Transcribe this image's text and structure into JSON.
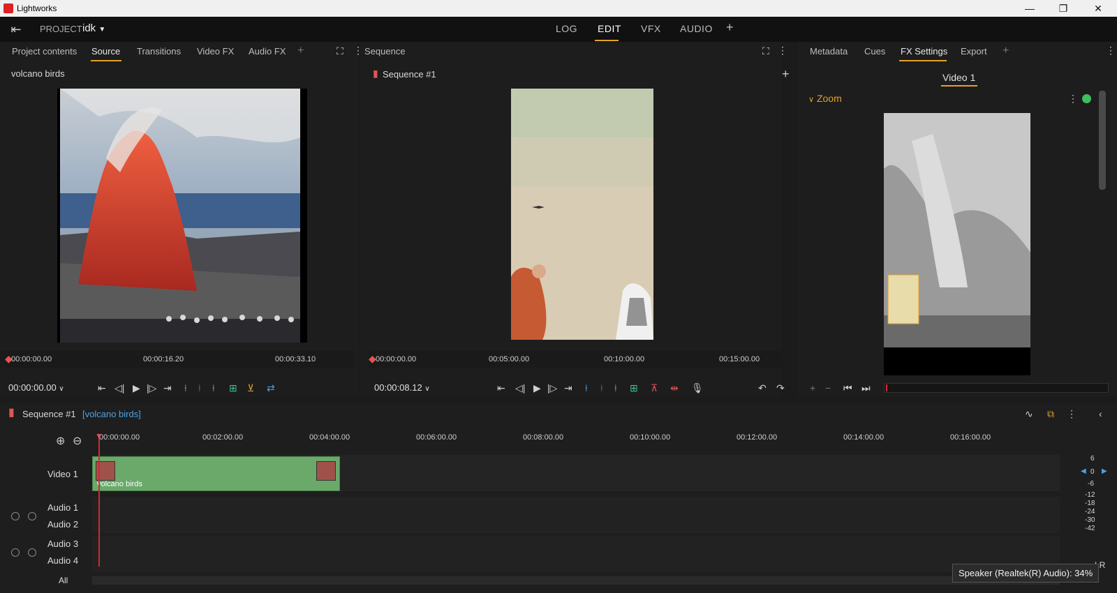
{
  "app": {
    "title": "Lightworks"
  },
  "window": {
    "minimize": "—",
    "maximize": "❐",
    "close": "✕"
  },
  "topbar": {
    "project_label": "PROJECT",
    "project_name": "idk",
    "nav": [
      "LOG",
      "EDIT",
      "VFX",
      "AUDIO"
    ],
    "active_nav": "EDIT",
    "add": "+"
  },
  "left_panel": {
    "tabs": [
      "Project contents",
      "Source",
      "Transitions",
      "Video FX",
      "Audio FX"
    ],
    "active_tab": "Source",
    "clip_title": "volcano birds",
    "ruler": [
      "00:00:00.00",
      "00:00:16.20",
      "00:00:33.10"
    ],
    "timecode": "00:00:00.00"
  },
  "center_panel": {
    "header": "Sequence",
    "sequence_title": "Sequence #1",
    "ruler": [
      "00:00:00.00",
      "00:05:00.00",
      "00:10:00.00",
      "00:15:00.00"
    ],
    "timecode": "00:00:08.12"
  },
  "right_panel": {
    "tabs": [
      "Metadata",
      "Cues",
      "FX Settings",
      "Export"
    ],
    "active_tab": "FX Settings",
    "track": "Video 1",
    "effect": "Zoom"
  },
  "timeline": {
    "title": "Sequence #1",
    "subtitle": "[volcano birds]",
    "ruler": [
      "00:00:00.00",
      "00:02:00.00",
      "00:04:00.00",
      "00:06:00.00",
      "00:08:00.00",
      "00:10:00.00",
      "00:12:00.00",
      "00:14:00.00",
      "00:16:00.00"
    ],
    "tracks": [
      "Video 1",
      "Audio 1",
      "Audio 2",
      "Audio 3",
      "Audio 4",
      "All"
    ],
    "clip_label": "volcano birds",
    "meter": [
      "6",
      "0",
      "-6",
      "-12",
      "-18",
      "-24",
      "-30",
      "-42"
    ],
    "lr": "LR"
  },
  "tooltip": "Speaker (Realtek(R) Audio): 34%",
  "colors": {
    "accent": "#e6a12a",
    "clip": "#6aa96a",
    "playhead": "#d42a2a",
    "blue": "#4aa3e8",
    "green": "#3cc28a"
  }
}
